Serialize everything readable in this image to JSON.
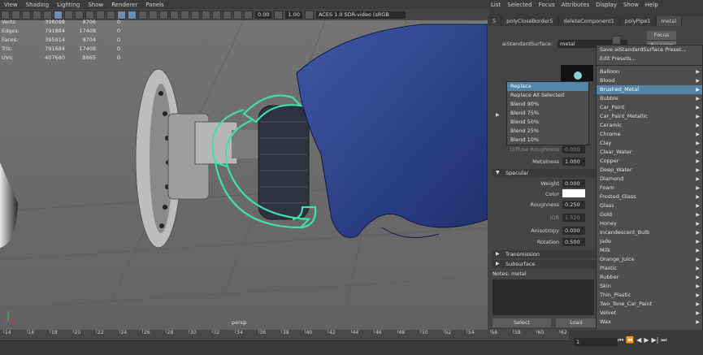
{
  "viewport": {
    "menu": [
      "View",
      "Shading",
      "Lighting",
      "Show",
      "Renderer",
      "Panels"
    ],
    "toolbar": {
      "field_a": "0.00",
      "field_b": "1.00",
      "color_space": "ACES 1.0 SDR-video (sRGB"
    },
    "hud": [
      {
        "label": "Verts:",
        "a": "396098",
        "b": "8706",
        "c": "0"
      },
      {
        "label": "Edges:",
        "a": "791884",
        "b": "17408",
        "c": "0"
      },
      {
        "label": "Faces:",
        "a": "395914",
        "b": "8704",
        "c": "0"
      },
      {
        "label": "Tris:",
        "a": "791684",
        "b": "17408",
        "c": "0"
      },
      {
        "label": "UVs:",
        "a": "407680",
        "b": "8865",
        "c": "0"
      }
    ],
    "camera": "persp"
  },
  "panel": {
    "menu": [
      "List",
      "Selected",
      "Focus",
      "Attributes",
      "Display",
      "Show",
      "Help"
    ],
    "tabs": [
      "polyCloseBorder5",
      "deleteComponent1",
      "polyPipe1",
      "metal"
    ],
    "tab_prefix": "5",
    "shader_label": "aiStandardSurface:",
    "shader_value": "metal",
    "focus_btn": "Focus",
    "presets_btn": "Presets*",
    "diffuse_roughness_label": "Diffuse Roughness",
    "diffuse_roughness_val": "0.000",
    "metalness_label": "Metalness",
    "metalness_val": "1.000",
    "specular_section": "Specular",
    "weight_label": "Weight",
    "weight_val": "0.000",
    "color_label": "Color",
    "roughness_label": "Roughness",
    "roughness_val": "0.250",
    "ior_label": "IOR",
    "ior_val": "1.520",
    "anisotropy_label": "Anisotropy",
    "anisotropy_val": "0.000",
    "rotation_label": "Rotation",
    "rotation_val": "0.500",
    "transmission_section": "Transmission",
    "subsurface_section": "Subsurface",
    "notes": "Notes: metal",
    "select_btn": "Select",
    "load_btn": "Load"
  },
  "blend_menu": [
    "Replace",
    "Replace All Selected",
    "Blend 90%",
    "Blend 75%",
    "Blend 50%",
    "Blend 25%",
    "Blend 10%"
  ],
  "preset_menu": {
    "top": [
      "Save aiStandardSurface Preset...",
      "Edit Presets..."
    ],
    "items": [
      "Balloon",
      "Blood",
      "Brushed_Metal",
      "Bubble",
      "Car_Paint",
      "Car_Paint_Metallic",
      "Ceramic",
      "Chrome",
      "Clay",
      "Clear_Water",
      "Copper",
      "Deep_Water",
      "Diamond",
      "Foam",
      "Frosted_Glass",
      "Glass",
      "Gold",
      "Honey",
      "Incandescent_Bulb",
      "Jade",
      "Milk",
      "Orange_Juice",
      "Plastic",
      "Rubber",
      "Skin",
      "Thin_Plastic",
      "Two_Tone_Car_Paint",
      "Velvet",
      "Wax"
    ],
    "highlighted": "Brushed_Metal"
  },
  "timeline": {
    "ticks": [
      "14",
      "16",
      "18",
      "20",
      "22",
      "24",
      "26",
      "28",
      "30",
      "32",
      "34",
      "36",
      "38",
      "40",
      "42",
      "44",
      "46",
      "48",
      "50",
      "52",
      "54",
      "56",
      "58",
      "60",
      "62"
    ],
    "current_frame": "1"
  }
}
